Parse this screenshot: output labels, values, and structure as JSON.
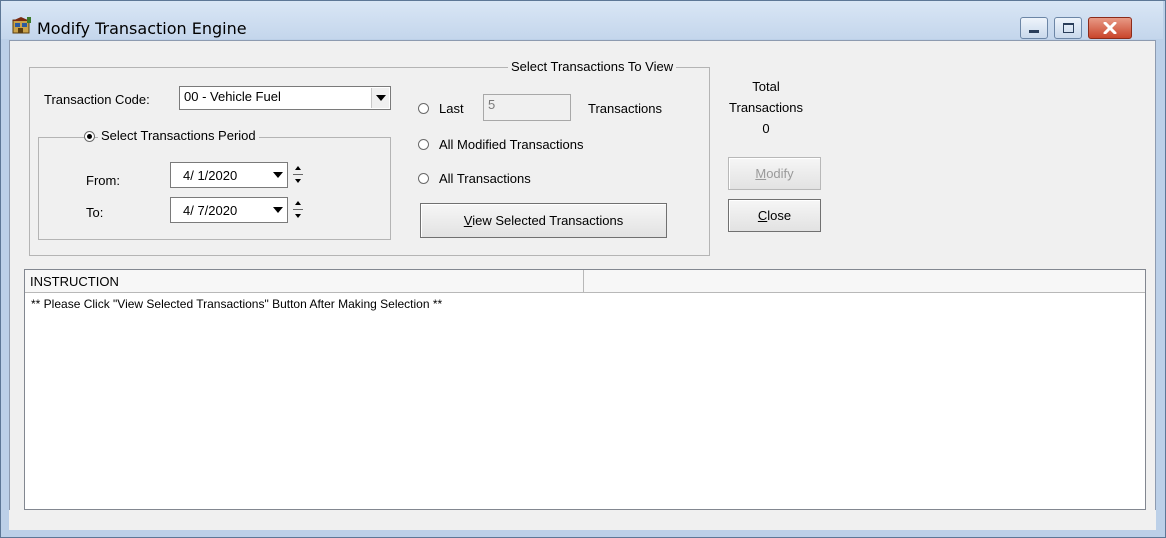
{
  "window": {
    "title": "Modify Transaction Engine"
  },
  "transaction_code": {
    "label": "Transaction Code:",
    "value": "00 - Vehicle Fuel"
  },
  "period": {
    "title": "Select Transactions Period",
    "from_label": "From:",
    "from_value": "4/  1/2020",
    "to_label": "To:",
    "to_value": "4/  7/2020"
  },
  "select_view": {
    "title": "Select Transactions To View",
    "last_label": "Last",
    "last_value": "5",
    "transactions_label": "Transactions",
    "all_modified_label": "All Modified Transactions",
    "all_label": "All Transactions",
    "view_button": "View Selected Transactions"
  },
  "totals": {
    "line1": "Total",
    "line2": "Transactions",
    "count": "0"
  },
  "buttons": {
    "modify": "Modify",
    "close": "Close"
  },
  "list": {
    "header": "INSTRUCTION",
    "rows": [
      "** Please Click \"View Selected Transactions\" Button After Making Selection **"
    ]
  }
}
